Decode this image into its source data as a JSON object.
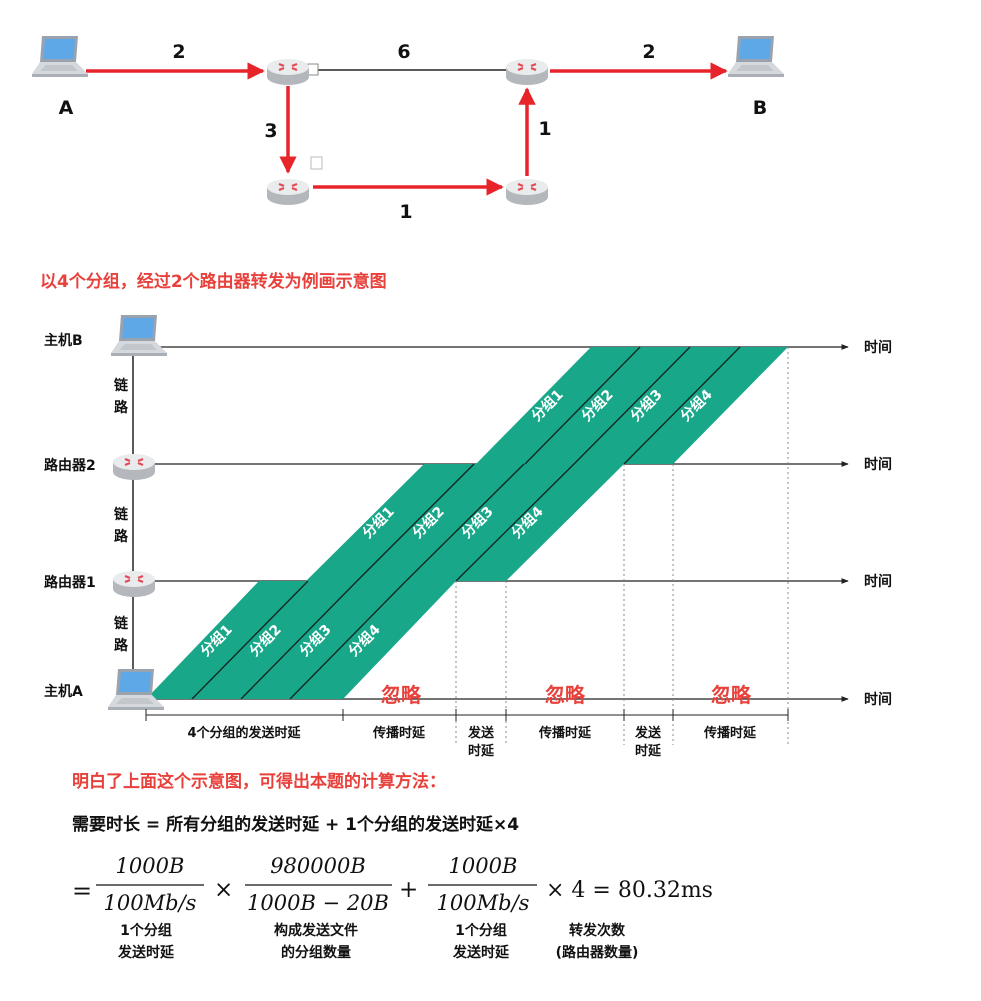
{
  "network": {
    "host_a": "A",
    "host_b": "B",
    "link_a_r1": "2",
    "link_r1_r3": "6",
    "link_r3_b": "2",
    "link_r1_r2": "3",
    "link_r2_r4": "1",
    "link_r4_r3": "1"
  },
  "colors": {
    "path_red": "#e8242b",
    "packet_green": "#18a889",
    "title_red": "#e8413c",
    "ignore_red": "#e8413c"
  },
  "section_title": "以4个分组，经过2个路由器转发为例画示意图",
  "timing": {
    "rows": [
      {
        "label": "主机B"
      },
      {
        "label": "路由器2"
      },
      {
        "label": "路由器1"
      },
      {
        "label": "主机A"
      }
    ],
    "time_label": "时间",
    "link_label_top": "链",
    "link_label_bottom": "路",
    "packet_prefix": "分组",
    "packets": [
      "1",
      "2",
      "3",
      "4"
    ],
    "ignore_label": "忽略",
    "segments": {
      "send4": "4个分组的发送时延",
      "prop": "传播时延",
      "send_top": "发送",
      "send_bottom": "时延"
    }
  },
  "explanation": {
    "heading": "明白了上面这个示意图，可得出本题的计算方法：",
    "formula_text": "需要时长 = 所有分组的发送时延 + 1个分组的发送时延×4",
    "eq": "=",
    "frac1_num": "1000B",
    "frac1_den": "100Mb/s",
    "times": "×",
    "frac2_num": "980000B",
    "frac2_den": "1000B − 20B",
    "plus": "+",
    "frac3_num": "1000B",
    "frac3_den": "100Mb/s",
    "tail": "× 4 = 80.32ms",
    "note1_a": "1个分组",
    "note1_b": "发送时延",
    "note2_a": "构成发送文件",
    "note2_b": "的分组数量",
    "note3_a": "1个分组",
    "note3_b": "发送时延",
    "note4_a": "转发次数",
    "note4_b": "(路由器数量)"
  }
}
